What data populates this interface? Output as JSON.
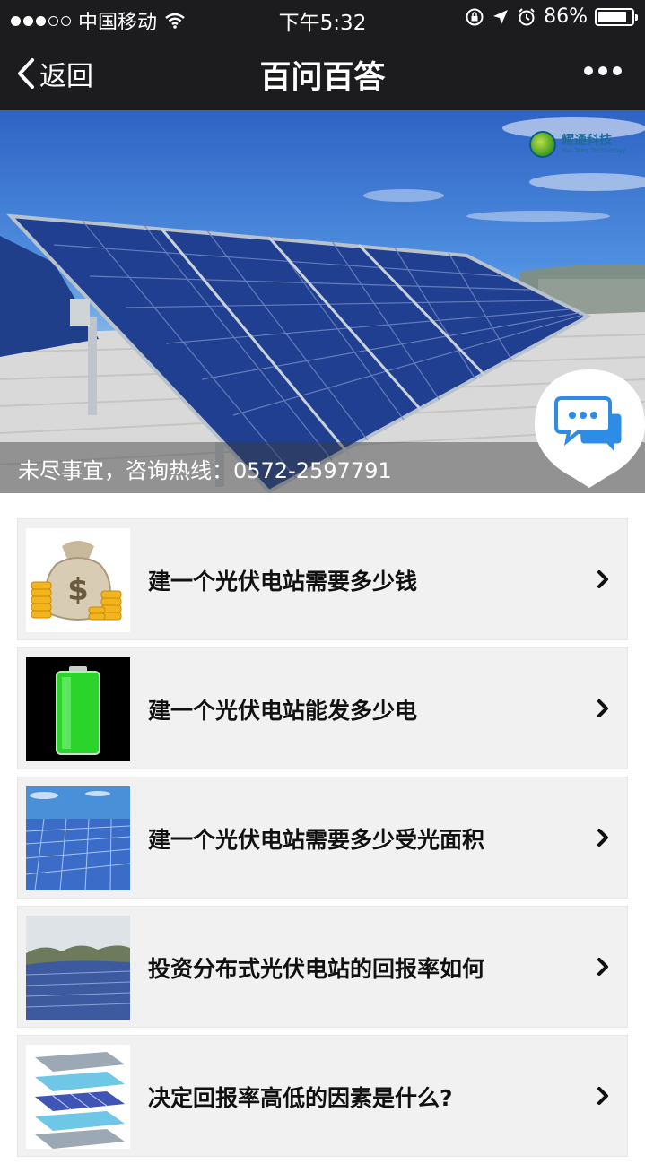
{
  "status_bar": {
    "carrier": "中国移动",
    "time": "下午5:32",
    "battery_percent": "86%",
    "battery_level": 0.86,
    "signal_strength": 3,
    "signal_max": 5
  },
  "nav": {
    "back_label": "返回",
    "title": "百问百答"
  },
  "banner": {
    "hotline_text": "未尽事宜，咨询热线：0572-2597791",
    "brand_name": "耀通科技",
    "brand_sub": "Yao Tong Technology"
  },
  "list": {
    "items": [
      {
        "label": "建一个光伏电站需要多少钱",
        "thumb": "money-bag-coins"
      },
      {
        "label": "建一个光伏电站能发多少电",
        "thumb": "green-battery"
      },
      {
        "label": "建一个光伏电站需要多少受光面积",
        "thumb": "solar-field"
      },
      {
        "label": "投资分布式光伏电站的回报率如何",
        "thumb": "hillside-solar-farm"
      },
      {
        "label": "决定回报率高低的因素是什么?",
        "thumb": "panel-layers"
      }
    ]
  },
  "colors": {
    "bar_bg": "#1c1c1e",
    "list_bg": "#f1f1f1",
    "chat_blue": "#2c8ce6"
  }
}
